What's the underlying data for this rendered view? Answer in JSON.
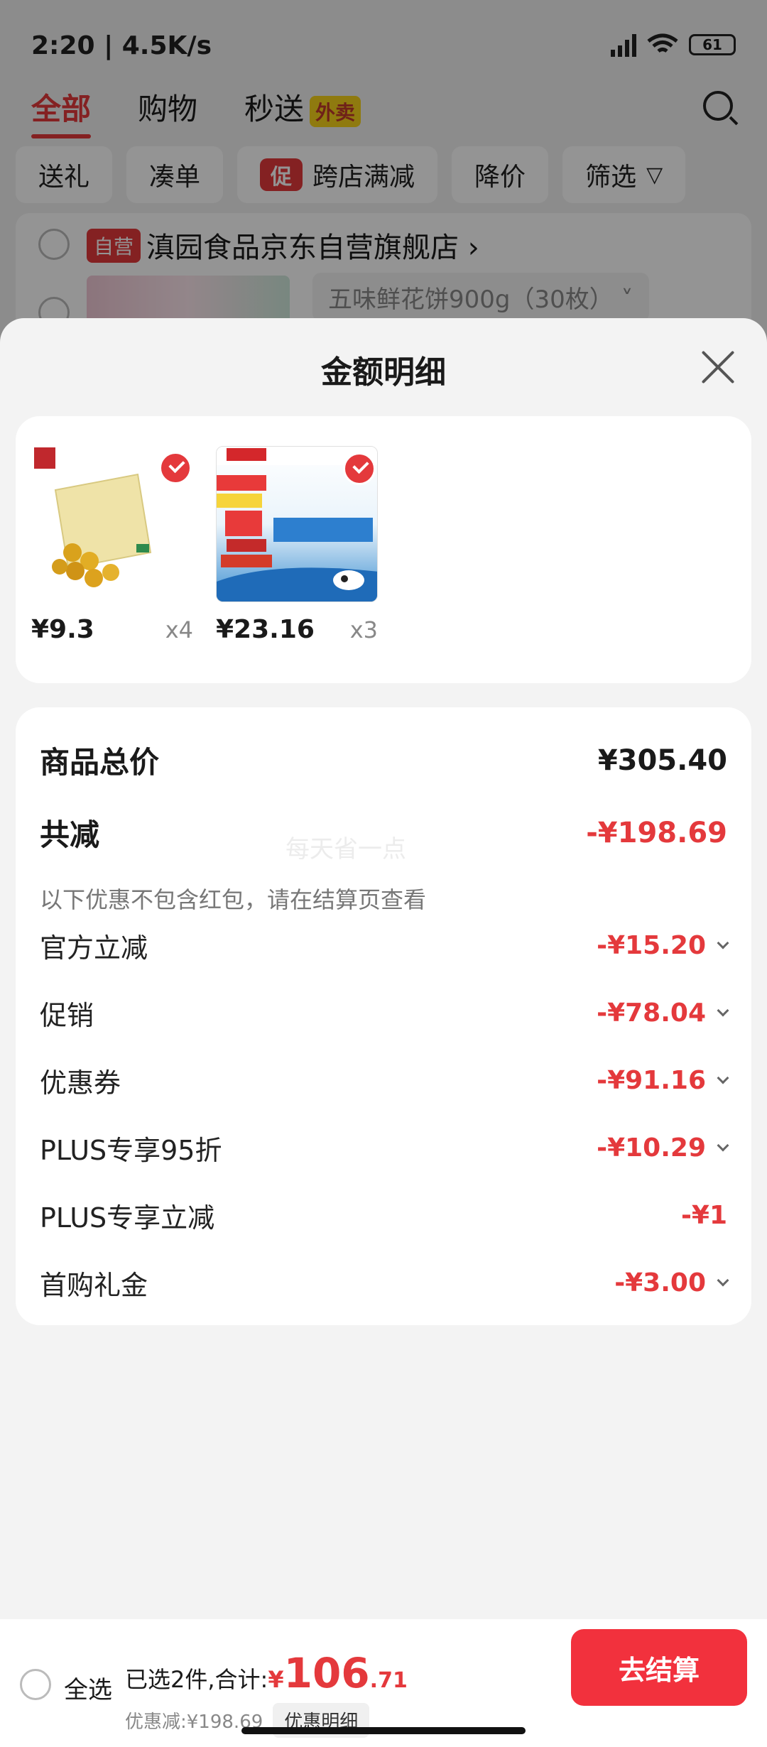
{
  "status": {
    "time_speed": "2:20 | 4.5K/s",
    "battery": "61"
  },
  "tabs": [
    {
      "label": "全部"
    },
    {
      "label": "购物"
    },
    {
      "label": "秒送",
      "badge": "外卖"
    }
  ],
  "chips": [
    "送礼",
    "凑单",
    "跨店满减",
    "降价",
    "筛选"
  ],
  "chip_promo_badge": "促",
  "store": {
    "badge": "自营",
    "name": "滇园食品京东自营旗舰店 ›",
    "spec": "五味鲜花饼900g（30枚） ˅"
  },
  "sheet": {
    "title": "金额明细",
    "items": [
      {
        "price": "¥9.3",
        "qty": "x4"
      },
      {
        "price": "¥23.16",
        "qty": "x3"
      }
    ],
    "total_label": "商品总价",
    "total_value": "¥305.40",
    "reduce_label": "共减",
    "reduce_value": "-¥198.69",
    "reduce_note": "以下优惠不包含红包，请在结算页查看",
    "watermark": "每天省一点",
    "lines": [
      {
        "label": "官方立减",
        "value": "-¥15.20",
        "expandable": true
      },
      {
        "label": "促销",
        "value": "-¥78.04",
        "expandable": true
      },
      {
        "label": "优惠券",
        "value": "-¥91.16",
        "expandable": true
      },
      {
        "label": "PLUS专享95折",
        "value": "-¥10.29",
        "expandable": true
      },
      {
        "label": "PLUS专享立减",
        "value": "-¥1",
        "expandable": false
      },
      {
        "label": "首购礼金",
        "value": "-¥3.00",
        "expandable": true
      }
    ]
  },
  "bottom": {
    "select_all": "全选",
    "selected_prefix": "已选2件,合计:",
    "yen": "¥",
    "total_int": "106",
    "total_dec": ".71",
    "discount": "优惠减:¥198.69",
    "detail_btn": "优惠明细",
    "checkout": "去结算"
  },
  "colors": {
    "accent": "#e4393c",
    "checkout": "#f2313d"
  }
}
